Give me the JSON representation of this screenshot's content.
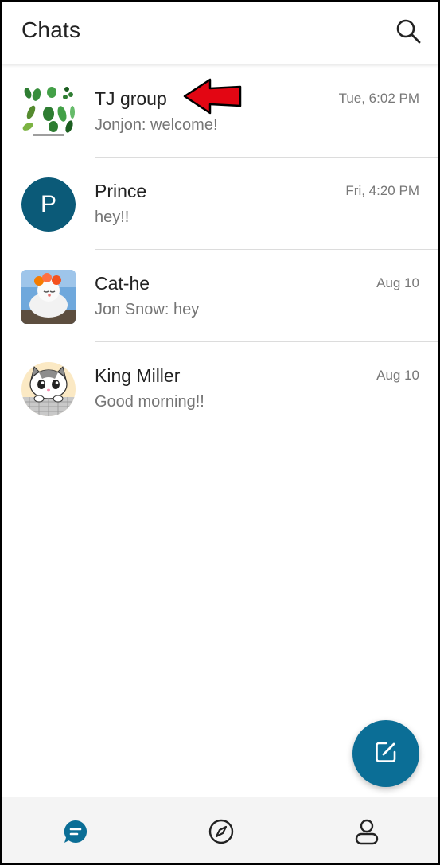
{
  "header": {
    "title": "Chats",
    "search_icon": "search-icon"
  },
  "chats": [
    {
      "name": "TJ group",
      "time": "Tue, 6:02 PM",
      "preview": "Jonjon: welcome!",
      "avatar": "leaves-image"
    },
    {
      "name": "Prince",
      "time": "Fri, 4:20 PM",
      "preview": "hey!!",
      "avatar_letter": "P",
      "avatar_color": "#0b5a78"
    },
    {
      "name": "Cat-he",
      "time": "Aug 10",
      "preview": "Jon Snow: hey",
      "avatar": "cat-photo"
    },
    {
      "name": "King Miller",
      "time": "Aug 10",
      "preview": "Good morning!!",
      "avatar": "cartoon-cat"
    }
  ],
  "annotation": {
    "icon": "red-arrow-icon",
    "color": "#e30613"
  },
  "fab": {
    "icon": "compose-icon",
    "color": "#0b6e96"
  },
  "bottom_nav": {
    "items": [
      {
        "icon": "chat-bubble-icon",
        "active": true
      },
      {
        "icon": "compass-icon",
        "active": false
      },
      {
        "icon": "person-icon",
        "active": false
      }
    ]
  },
  "colors": {
    "accent": "#0b6e96",
    "avatar": "#0b5a78"
  }
}
